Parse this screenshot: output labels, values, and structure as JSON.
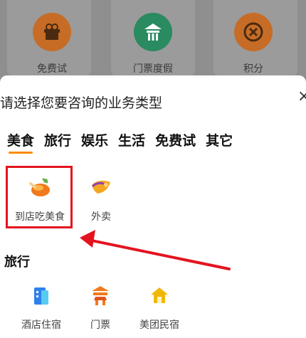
{
  "background_items": [
    {
      "label": "免费试",
      "icon": "gift-box-icon",
      "color": "#e07a2a"
    },
    {
      "label": "门票度假",
      "icon": "temple-gate-icon",
      "color": "#2e9e6e"
    },
    {
      "label": "积分",
      "icon": "points-coin-icon",
      "color": "#e07a2a"
    }
  ],
  "sheet": {
    "title": "请选择您要咨询的业务类型",
    "close_label": "×"
  },
  "tabs": [
    "美食",
    "旅行",
    "娱乐",
    "生活",
    "免费试",
    "其它"
  ],
  "active_tab": "美食",
  "food_services": [
    {
      "label": "到店吃美食",
      "icon": "roast-chicken-icon"
    },
    {
      "label": "外卖",
      "icon": "delivery-food-icon"
    }
  ],
  "travel_section": {
    "title": "旅行",
    "services": [
      {
        "label": "酒店住宿",
        "icon": "hotel-building-icon"
      },
      {
        "label": "门票",
        "icon": "ticket-gate-icon"
      },
      {
        "label": "美团民宿",
        "icon": "homestay-house-icon"
      }
    ]
  },
  "colors": {
    "accent": "#ff8a00",
    "highlight_box": "#e3141f",
    "arrow": "#e3141f",
    "overlay": "#8f8f8f"
  }
}
